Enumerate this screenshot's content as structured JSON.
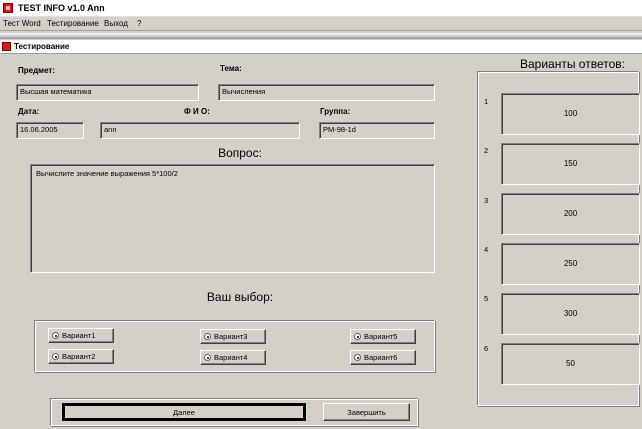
{
  "window": {
    "title": "TEST INFO v1.0 Ann"
  },
  "menu": [
    {
      "label": "Тест Word"
    },
    {
      "label": "Тестирование"
    },
    {
      "label": "Выход"
    },
    {
      "label": "?"
    }
  ],
  "child_window": {
    "title": "Тестирование"
  },
  "form": {
    "subject_label": "Предмет:",
    "subject_value": "Высшая математика",
    "topic_label": "Тема:",
    "topic_value": "Вычисления",
    "date_label": "Дата:",
    "date_value": "16.06.2005",
    "fio_label": "Ф И О:",
    "fio_value": "ann",
    "group_label": "Группа:",
    "group_value": "PM-98-1d"
  },
  "question": {
    "heading": "Вопрос:",
    "text": "Вычислите значение выражения 5*100/2"
  },
  "choice": {
    "heading": "Ваш выбор:",
    "options": [
      "Вариант1",
      "Вариант2",
      "Вариант3",
      "Вариант4",
      "Вариант5",
      "Вариант6"
    ]
  },
  "buttons": {
    "next": "Далее",
    "finish": "Завершить"
  },
  "answers": {
    "heading": "Варианты ответов:",
    "items": [
      {
        "num": "1",
        "value": "100"
      },
      {
        "num": "2",
        "value": "150"
      },
      {
        "num": "3",
        "value": "200"
      },
      {
        "num": "4",
        "value": "250"
      },
      {
        "num": "5",
        "value": "300"
      },
      {
        "num": "6",
        "value": "50"
      }
    ]
  }
}
